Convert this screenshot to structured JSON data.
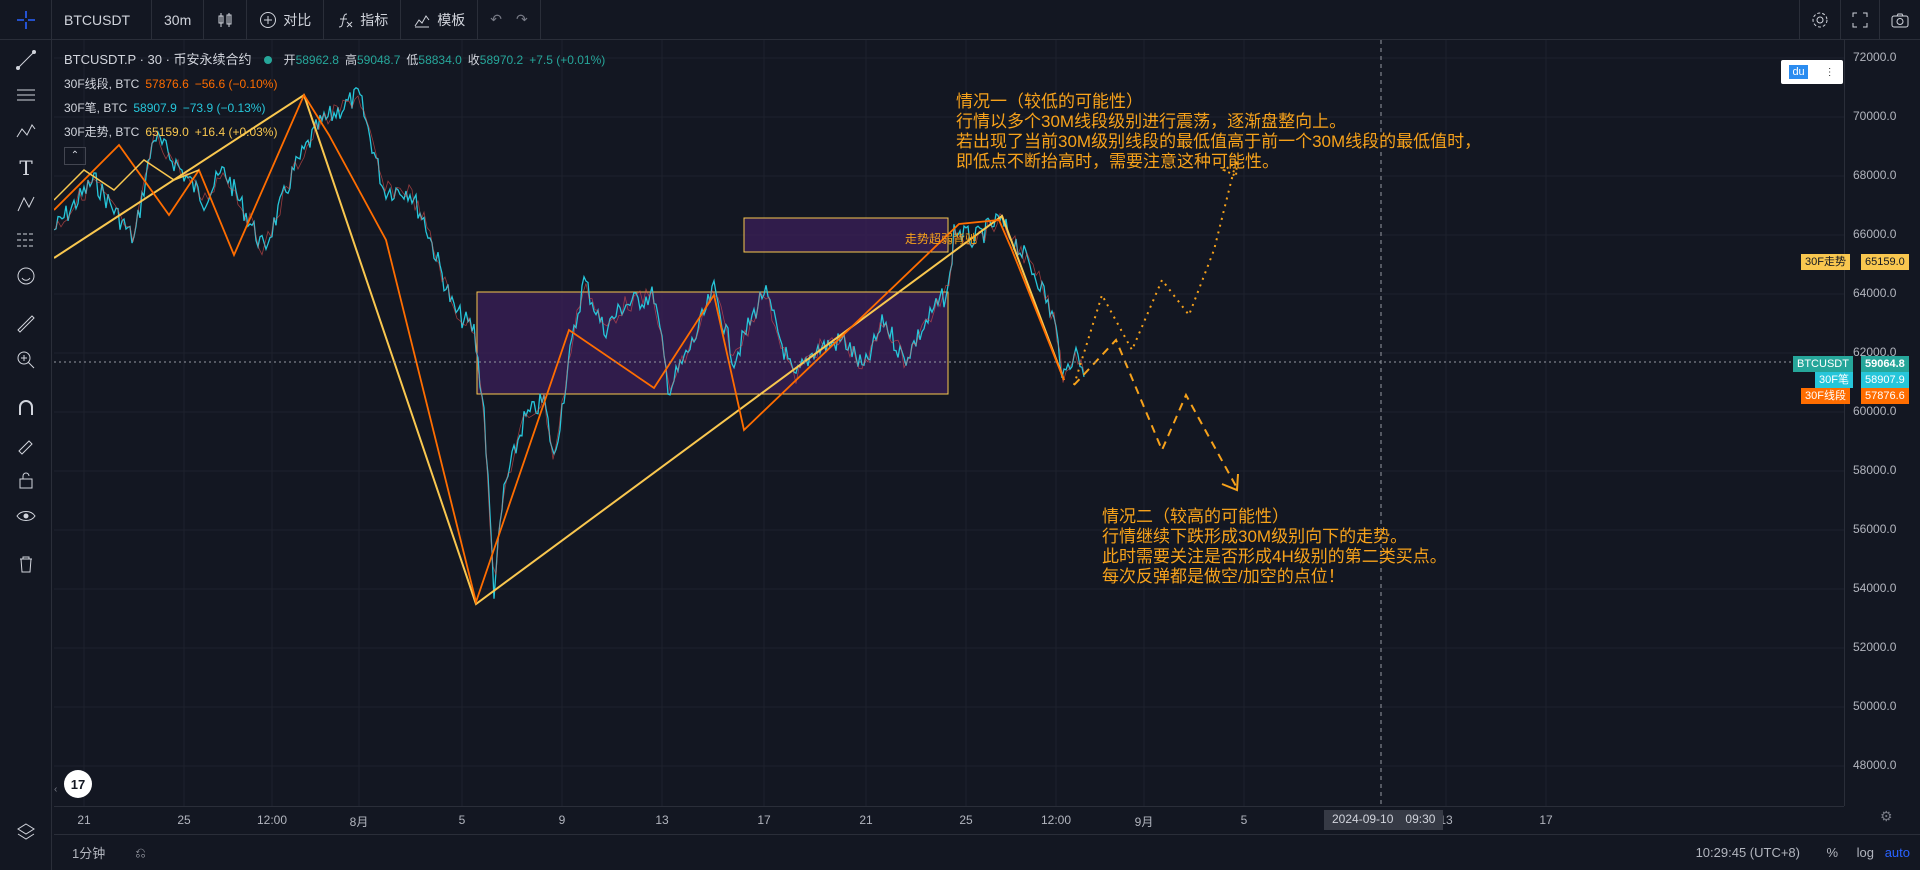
{
  "topbar": {
    "symbol": "BTCUSDT",
    "interval": "30m",
    "compare_label": "对比",
    "indicators_label": "指标",
    "templates_label": "模板"
  },
  "legend": {
    "title": "BTCUSDT.P · 30 · 币安永续合约",
    "open_label": "开",
    "open": "58962.8",
    "high_label": "高",
    "high": "59048.7",
    "low_label": "低",
    "low": "58834.0",
    "close_label": "收",
    "close": "58970.2",
    "change": "+7.5 (+0.01%)",
    "ind1_name": "30F线段, BTC",
    "ind1_value": "57876.6",
    "ind1_change": "−56.6 (−0.10%)",
    "ind2_name": "30F笔, BTC",
    "ind2_value": "58907.9",
    "ind2_change": "−73.9 (−0.13%)",
    "ind3_name": "30F走势, BTC",
    "ind3_value": "65159.0",
    "ind3_change": "+16.4 (+0.03%)"
  },
  "annotations": {
    "scenario1": "情况一（较低的可能性）\n行情以多个30M线段级别进行震荡，逐渐盘整向上。\n若出现了当前30M级别线段的最低值高于前一个30M线段的最低值时，\n即低点不断抬高时，需要注意这种可能性。",
    "scenario2": "情况二（较高的可能性）\n行情继续下跌形成30M级别向下的走势。\n此时需要关注是否形成4H级别的第二类买点。\n每次反弹都是做空/加空的点位！",
    "box_label": "走势超弱背驰"
  },
  "price_axis": {
    "ticks": [
      "72000.0",
      "70000.0",
      "68000.0",
      "66000.0",
      "64000.0",
      "62000.0",
      "60000.0",
      "58000.0",
      "56000.0",
      "54000.0",
      "52000.0",
      "50000.0",
      "48000.0"
    ],
    "tag_trend_name": "30F走势",
    "tag_trend_value": "65159.0",
    "tag_symbol_name": "BTCUSDT",
    "tag_symbol_value": "59064.8",
    "tag_bi_name": "30F笔",
    "tag_bi_value": "58907.9",
    "tag_seg_name": "30F线段",
    "tag_seg_value": "57876.6"
  },
  "time_axis": {
    "ticks": [
      "21",
      "25",
      "12:00",
      "8月",
      "5",
      "9",
      "13",
      "17",
      "21",
      "25",
      "12:00",
      "9月",
      "5",
      "13",
      "17"
    ],
    "crosshair_date": "2024-09-10",
    "crosshair_time": "09:30"
  },
  "bottombar": {
    "interval_label": "1分钟",
    "clock": "10:29:45 (UTC+8)",
    "percent_label": "%",
    "log_label": "log",
    "auto_label": "auto"
  },
  "colors": {
    "background": "#131722",
    "candle_up": "#26a69a",
    "candle_down": "#ef5350",
    "segment_line": "#ff6d00",
    "bi_line": "#26c6da",
    "trend_line": "#f9c74f",
    "box_fill": "#3b1f5a",
    "annotation": "#f7a21b"
  }
}
